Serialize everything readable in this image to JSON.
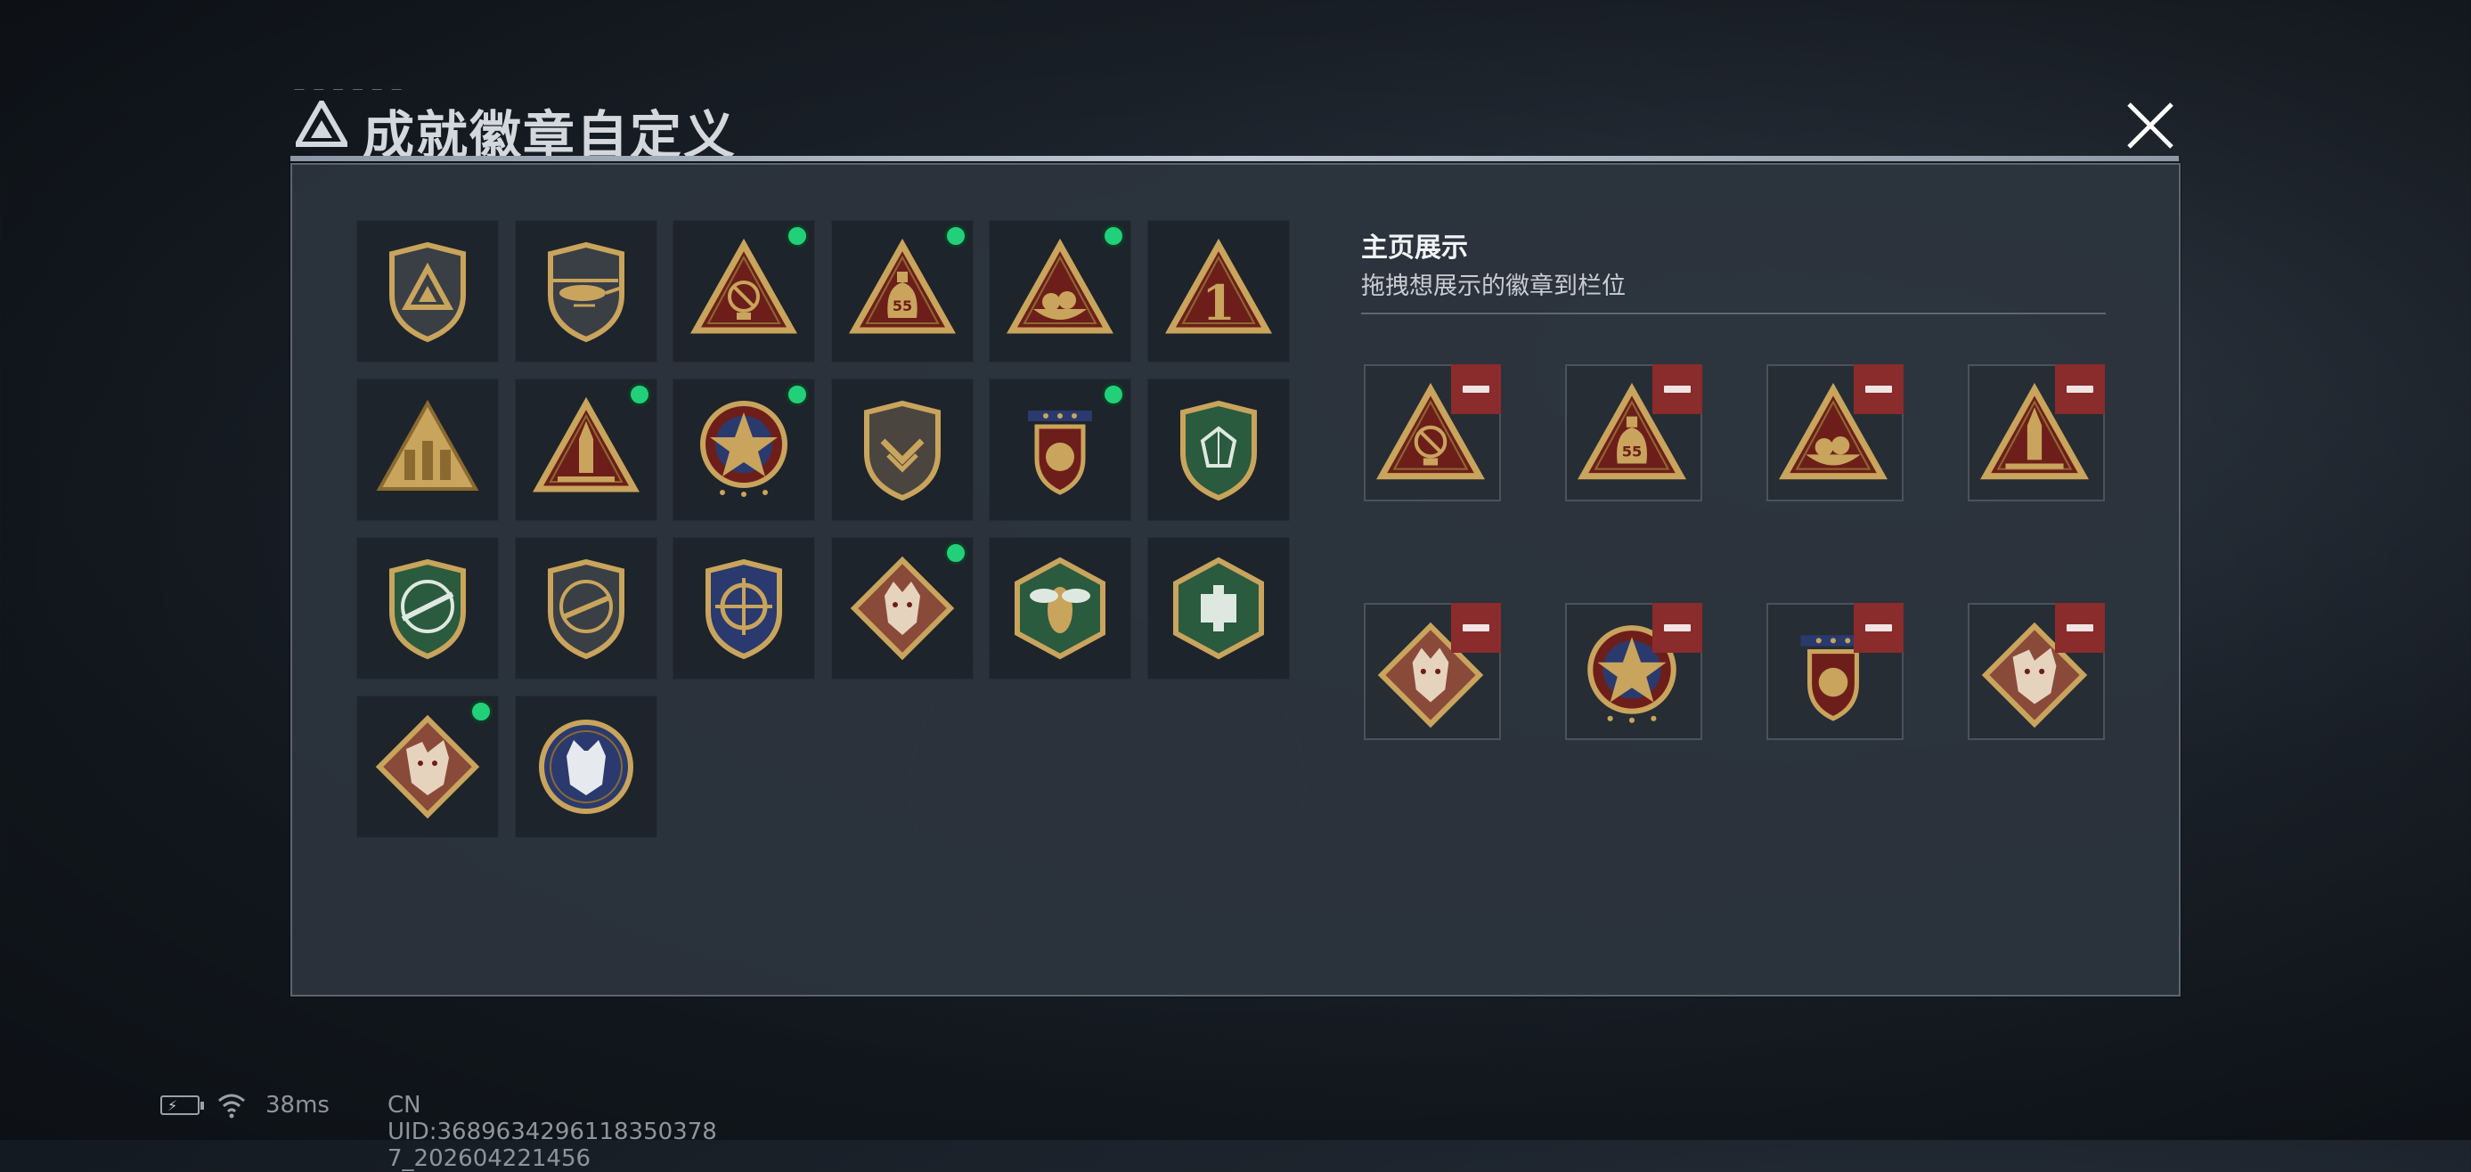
{
  "header": {
    "title": "成就徽章自定义",
    "close_icon": "close-icon"
  },
  "badges": [
    {
      "name": "shield-triangle-badge",
      "new": false
    },
    {
      "name": "helicopter-badge",
      "new": false
    },
    {
      "name": "radar-dish-badge",
      "new": true
    },
    {
      "name": "bag-55-badge",
      "new": true
    },
    {
      "name": "nest-badge",
      "new": true
    },
    {
      "name": "number-one-badge",
      "new": false
    },
    {
      "name": "soldiers-badge",
      "new": false
    },
    {
      "name": "rocket-badge",
      "new": true
    },
    {
      "name": "star-medal-badge",
      "new": true
    },
    {
      "name": "shield-chevron-badge",
      "new": false
    },
    {
      "name": "laurel-stars-badge",
      "new": true
    },
    {
      "name": "green-crest-badge",
      "new": false
    },
    {
      "name": "rifle-green-badge",
      "new": false
    },
    {
      "name": "rifle-shield-badge",
      "new": false
    },
    {
      "name": "crosshair-shield-badge",
      "new": false
    },
    {
      "name": "wolf-badge",
      "new": true
    },
    {
      "name": "hornet-badge",
      "new": false
    },
    {
      "name": "green-hex-badge",
      "new": false
    },
    {
      "name": "dragon-badge",
      "new": true
    },
    {
      "name": "wildcat-badge",
      "new": false
    }
  ],
  "showcase": {
    "title": "主页展示",
    "subtitle": "拖拽想展示的徽章到栏位",
    "slots": [
      {
        "badge": "radar-dish-badge"
      },
      {
        "badge": "bag-55-badge"
      },
      {
        "badge": "nest-badge"
      },
      {
        "badge": "rocket-badge"
      },
      {
        "badge": "wolf-badge"
      },
      {
        "badge": "star-medal-badge"
      },
      {
        "badge": "laurel-stars-badge"
      },
      {
        "badge": "dragon-badge"
      }
    ]
  },
  "status_bar": {
    "battery_icon": "battery-charging-icon",
    "wifi_icon": "wifi-icon",
    "ping": "38ms",
    "uid": "CN UID:3689634296118350378​7_202604221456"
  },
  "colors": {
    "new_dot": "#22d07a",
    "remove": "#8a2b2c",
    "gold": "#c9a45c",
    "red_bg": "#6e1e1a",
    "green_bg": "#2a5b3e"
  }
}
